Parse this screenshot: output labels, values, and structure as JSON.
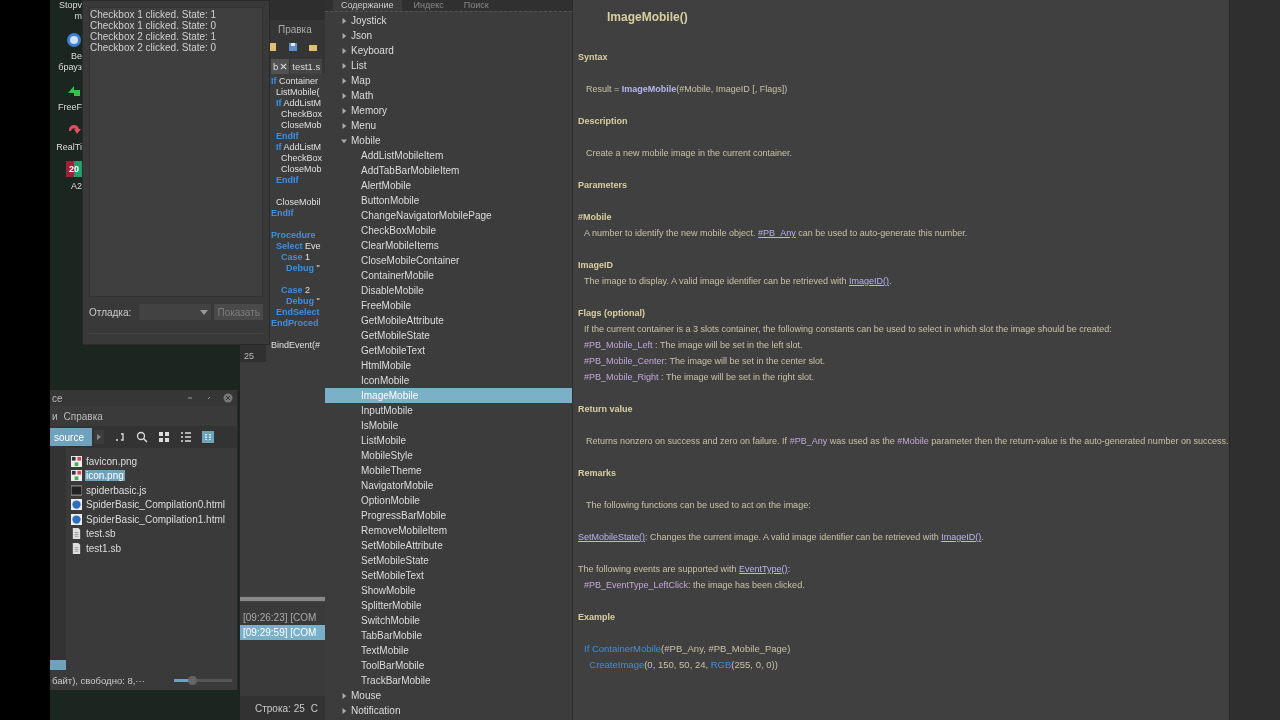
{
  "desktop_icons": [
    {
      "kind": "none",
      "lines": [
        "Stopv",
        "m"
      ]
    },
    {
      "kind": "globe",
      "lines": [
        "Ве",
        "брауз"
      ]
    },
    {
      "kind": "share",
      "lines": [
        "FreeF"
      ]
    },
    {
      "kind": "refresh",
      "lines": [
        "RealTi"
      ]
    },
    {
      "kind": "tiles",
      "badge": "20",
      "lines": [
        "A2"
      ]
    }
  ],
  "debug_window": {
    "log": [
      "Checkbox 1 clicked. State: 1",
      "Checkbox 1 clicked. State: 0",
      "Checkbox 2 clicked. State: 1",
      "Checkbox 2 clicked. State: 0"
    ],
    "filter_label": "Отладка:",
    "show_button": {
      "label": "Показать",
      "disabled": true
    }
  },
  "ide": {
    "menu": [
      "Правка"
    ],
    "tabs": [
      {
        "label": "b",
        "closable": true,
        "selected": true
      },
      {
        "label": "test1.s",
        "closable": false,
        "selected": false
      }
    ],
    "code_blocks": [
      [
        {
          "keyword": "If",
          "text": " Container"
        },
        {
          "text": "  ListMobile("
        },
        {
          "keyword": "  If",
          "text": " AddListM"
        },
        {
          "text": "    CheckBox"
        },
        {
          "text": "    CloseMob"
        },
        {
          "keyword": "  EndIf"
        },
        {
          "keyword": "  If",
          "text": " AddListM"
        },
        {
          "text": "    CheckBox"
        },
        {
          "text": "    CloseMob"
        },
        {
          "keyword": "  EndIf"
        }
      ],
      [
        {
          "text": "  CloseMobil"
        },
        {
          "keyword": "EndIf"
        }
      ],
      [
        {
          "keyword": "Procedure"
        },
        {
          "keyword": "  Select",
          "text": " Eve"
        },
        {
          "keyword": "    Case",
          "text": " 1"
        },
        {
          "keyword": "      Debug",
          "text": " \""
        }
      ],
      [
        {
          "keyword": "    Case",
          "text": " 2"
        },
        {
          "keyword": "      Debug",
          "text": " \""
        },
        {
          "keyword": "  EndSelect"
        },
        {
          "keyword": "EndProced"
        }
      ],
      [
        {
          "text": "BindEvent(#"
        }
      ]
    ],
    "line_numbers": [
      "25"
    ],
    "log": [
      {
        "text": "[09:26:23] [COM",
        "selected": false
      },
      {
        "text": "[09:29:59] [COM",
        "selected": true
      }
    ],
    "status": "Строка: 25",
    "status_2": "С"
  },
  "file_manager": {
    "title": "ce",
    "menu": [
      "и",
      "Справка"
    ],
    "path": "source",
    "files": [
      {
        "name": "favicon.png",
        "kind": "image",
        "selected": false
      },
      {
        "name": "icon.png",
        "kind": "image",
        "selected": true
      },
      {
        "name": "spiderbasic.js",
        "kind": "script",
        "selected": false
      },
      {
        "name": "SpiderBasic_Compilation0.html",
        "kind": "web",
        "selected": false
      },
      {
        "name": "SpiderBasic_Compilation1.html",
        "kind": "web",
        "selected": false
      },
      {
        "name": "test.sb",
        "kind": "doc",
        "selected": false
      },
      {
        "name": "test1.sb",
        "kind": "doc",
        "selected": false
      }
    ],
    "status": "байт), свободно: 8,···",
    "zoom": {
      "level": 0.33
    }
  },
  "help": {
    "tabs": [
      {
        "label": "Содержание",
        "selected": true
      },
      {
        "label": "Индекс",
        "selected": false
      },
      {
        "label": "Поиск",
        "selected": false
      }
    ],
    "tree": [
      {
        "label": "Joystick",
        "expanded": false,
        "selected": false
      },
      {
        "label": "Json",
        "expanded": false,
        "selected": false
      },
      {
        "label": "Keyboard",
        "expanded": false,
        "selected": false
      },
      {
        "label": "List",
        "expanded": false,
        "selected": false
      },
      {
        "label": "Map",
        "expanded": false,
        "selected": false
      },
      {
        "label": "Math",
        "expanded": false,
        "selected": false
      },
      {
        "label": "Memory",
        "expanded": false,
        "selected": false
      },
      {
        "label": "Menu",
        "expanded": false,
        "selected": false
      },
      {
        "label": "Mobile",
        "expanded": true,
        "selected": false,
        "children": [
          {
            "label": "AddListMobileItem",
            "selected": false
          },
          {
            "label": "AddTabBarMobileItem",
            "selected": false
          },
          {
            "label": "AlertMobile",
            "selected": false
          },
          {
            "label": "ButtonMobile",
            "selected": false
          },
          {
            "label": "ChangeNavigatorMobilePage",
            "selected": false
          },
          {
            "label": "CheckBoxMobile",
            "selected": false
          },
          {
            "label": "ClearMobileItems",
            "selected": false
          },
          {
            "label": "CloseMobileContainer",
            "selected": false
          },
          {
            "label": "ContainerMobile",
            "selected": false
          },
          {
            "label": "DisableMobile",
            "selected": false
          },
          {
            "label": "FreeMobile",
            "selected": false
          },
          {
            "label": "GetMobileAttribute",
            "selected": false
          },
          {
            "label": "GetMobileState",
            "selected": false
          },
          {
            "label": "GetMobileText",
            "selected": false
          },
          {
            "label": "HtmlMobile",
            "selected": false
          },
          {
            "label": "IconMobile",
            "selected": false
          },
          {
            "label": "ImageMobile",
            "selected": true
          },
          {
            "label": "InputMobile",
            "selected": false
          },
          {
            "label": "IsMobile",
            "selected": false
          },
          {
            "label": "ListMobile",
            "selected": false
          },
          {
            "label": "MobileStyle",
            "selected": false
          },
          {
            "label": "MobileTheme",
            "selected": false
          },
          {
            "label": "NavigatorMobile",
            "selected": false
          },
          {
            "label": "OptionMobile",
            "selected": false
          },
          {
            "label": "ProgressBarMobile",
            "selected": false
          },
          {
            "label": "RemoveMobileItem",
            "selected": false
          },
          {
            "label": "SetMobileAttribute",
            "selected": false
          },
          {
            "label": "SetMobileState",
            "selected": false
          },
          {
            "label": "SetMobileText",
            "selected": false
          },
          {
            "label": "ShowMobile",
            "selected": false
          },
          {
            "label": "SplitterMobile",
            "selected": false
          },
          {
            "label": "SwitchMobile",
            "selected": false
          },
          {
            "label": "TabBarMobile",
            "selected": false
          },
          {
            "label": "TextMobile",
            "selected": false
          },
          {
            "label": "ToolBarMobile",
            "selected": false
          },
          {
            "label": "TrackBarMobile",
            "selected": false
          }
        ]
      },
      {
        "label": "Mouse",
        "expanded": false,
        "selected": false
      },
      {
        "label": "Notification",
        "expanded": false,
        "selected": false
      }
    ],
    "title": "ImageMobile()",
    "blocks": [
      {
        "kind": "heading",
        "text": "Syntax"
      },
      {
        "kind": "lead",
        "parts": [
          {
            "kind": "plain",
            "text": "Result = "
          },
          {
            "kind": "func",
            "text": "ImageMobile"
          },
          {
            "kind": "plain",
            "text": "(#Mobile, ImageID [, Flags])"
          }
        ]
      },
      {
        "kind": "heading",
        "text": "Description"
      },
      {
        "kind": "lead",
        "parts": [
          {
            "kind": "plain",
            "text": "Create a new mobile image in the current container."
          }
        ]
      },
      {
        "kind": "heading",
        "text": "Parameters"
      },
      {
        "kind": "subheading",
        "text": "#Mobile"
      },
      {
        "kind": "item",
        "parts": [
          {
            "kind": "plain",
            "text": "A number to identify the new mobile object. "
          },
          {
            "kind": "link",
            "text": "#PB_Any"
          },
          {
            "kind": "plain",
            "text": " can be used to auto-generate this number."
          }
        ]
      },
      {
        "kind": "subheading",
        "text": "ImageID"
      },
      {
        "kind": "item",
        "parts": [
          {
            "kind": "plain",
            "text": "The image to display. A valid image identifier can be retrieved with "
          },
          {
            "kind": "link",
            "text": "ImageID()"
          },
          {
            "kind": "plain",
            "text": "."
          }
        ]
      },
      {
        "kind": "subheading",
        "text": "Flags (optional)"
      },
      {
        "kind": "item",
        "parts": [
          {
            "kind": "plain",
            "text": "If the current container is a 3 slots container, the following constants can be used to select in which slot the image should be created:"
          }
        ]
      },
      {
        "kind": "item",
        "parts": [
          {
            "kind": "const",
            "text": "#PB_Mobile_Left"
          },
          {
            "kind": "plain",
            "text": "  : The image will be set in the left slot."
          }
        ]
      },
      {
        "kind": "item",
        "parts": [
          {
            "kind": "const",
            "text": "#PB_Mobile_Center"
          },
          {
            "kind": "plain",
            "text": ": The image will be set in the center slot."
          }
        ]
      },
      {
        "kind": "item",
        "parts": [
          {
            "kind": "const",
            "text": "#PB_Mobile_Right"
          },
          {
            "kind": "plain",
            "text": " : The image will be set in the right slot."
          }
        ]
      },
      {
        "kind": "heading",
        "text": "Return value"
      },
      {
        "kind": "lead",
        "parts": [
          {
            "kind": "plain",
            "text": "Returns nonzero on success and zero on failure. If "
          },
          {
            "kind": "const",
            "text": "#PB_Any"
          },
          {
            "kind": "plain",
            "text": " was used as the "
          },
          {
            "kind": "const",
            "text": "#Mobile"
          },
          {
            "kind": "plain",
            "text": " parameter then the return-value is the auto-generated number on success."
          }
        ]
      },
      {
        "kind": "heading",
        "text": "Remarks"
      },
      {
        "kind": "lead",
        "parts": [
          {
            "kind": "plain",
            "text": "The following functions can be used to act on the image:"
          }
        ]
      },
      {
        "kind": "note",
        "parts": [
          {
            "kind": "link",
            "text": "SetMobileState()"
          },
          {
            "kind": "plain",
            "text": ": Changes the current image. A valid image identifier can be retrieved with "
          },
          {
            "kind": "link",
            "text": "ImageID()"
          },
          {
            "kind": "plain",
            "text": "."
          }
        ]
      },
      {
        "kind": "note",
        "parts": [
          {
            "kind": "plain",
            "text": "The following events are supported with "
          },
          {
            "kind": "link",
            "text": "EventType()"
          },
          {
            "kind": "plain",
            "text": ":"
          }
        ]
      },
      {
        "kind": "item",
        "parts": [
          {
            "kind": "const",
            "text": "#PB_EventType_LeftClick"
          },
          {
            "kind": "plain",
            "text": ": the image has been clicked."
          }
        ]
      },
      {
        "kind": "heading",
        "text": "Example"
      },
      {
        "kind": "code",
        "parts": [
          {
            "kind": "keyword",
            "text": "If "
          },
          {
            "kind": "keyword",
            "text": "ContainerMobile"
          },
          {
            "kind": "plain",
            "text": "(#PB_Any, #PB_Mobile_Page)"
          }
        ]
      },
      {
        "kind": "code",
        "parts": [
          {
            "kind": "keyword",
            "text": "  CreateImage"
          },
          {
            "kind": "plain",
            "text": "(0, 150, 50, 24, "
          },
          {
            "kind": "keyword",
            "text": "RGB"
          },
          {
            "kind": "plain",
            "text": "(255, 0, 0))"
          }
        ]
      }
    ]
  }
}
